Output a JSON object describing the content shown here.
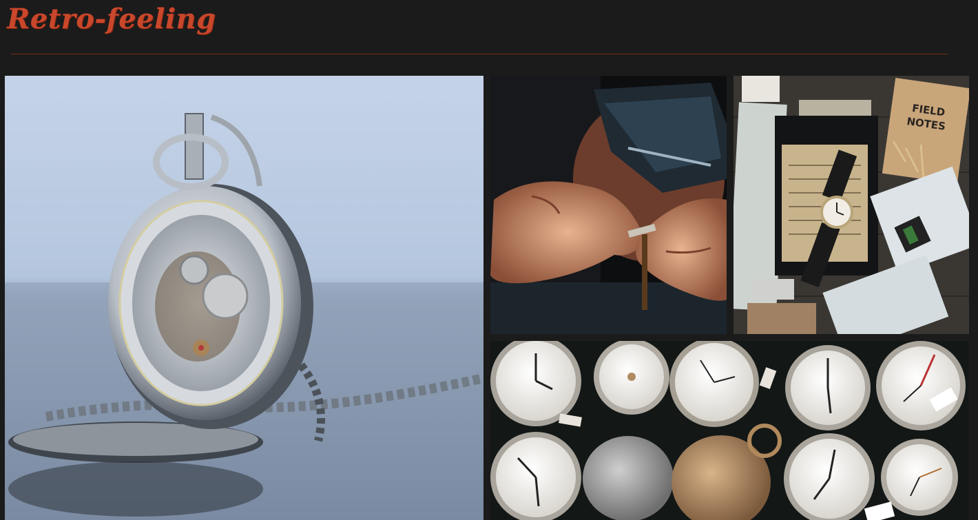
{
  "header": {
    "logo_text": "Retro-feeling"
  },
  "gallery": {
    "items": [
      {
        "icon": "pocket-watch-photo"
      },
      {
        "icon": "watchmaker-hands-photo"
      },
      {
        "icon": "travel-flatlay-photo"
      },
      {
        "icon": "pocket-watch-collection-photo"
      }
    ]
  },
  "colors": {
    "background": "#1b1b1b",
    "accent": "#c9472b",
    "divider": "#7a2b1c"
  }
}
